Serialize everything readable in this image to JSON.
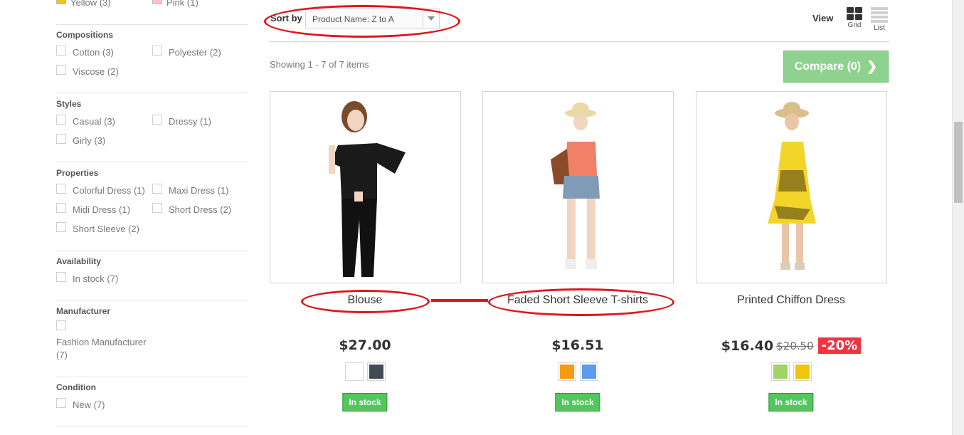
{
  "sidebar": {
    "colors_partial": [
      {
        "label": "Yellow (3)",
        "swatch": "#f1c40f"
      },
      {
        "label": "Pink (1)",
        "swatch": "#fcc2c6"
      }
    ],
    "compositions": {
      "title": "Compositions",
      "options": [
        "Cotton (3)",
        "Polyester (2)",
        "Viscose (2)"
      ]
    },
    "styles": {
      "title": "Styles",
      "options": [
        "Casual (3)",
        "Dressy (1)",
        "Girly (3)"
      ]
    },
    "properties": {
      "title": "Properties",
      "options": [
        "Colorful Dress (1)",
        "Maxi Dress (1)",
        "Midi Dress (1)",
        "Short Dress (2)",
        "Short Sleeve (2)"
      ]
    },
    "availability": {
      "title": "Availability",
      "options": [
        "In stock (7)"
      ]
    },
    "manufacturer": {
      "title": "Manufacturer",
      "options": [
        "Fashion Manufacturer",
        "(7)"
      ]
    },
    "condition": {
      "title": "Condition",
      "options": [
        "New (7)"
      ]
    }
  },
  "toolbar": {
    "sort_label": "Sort by",
    "sort_value": "Product Name: Z to A",
    "view_label": "View",
    "grid_label": "Grid",
    "list_label": "List",
    "showing": "Showing 1 - 7 of 7 items",
    "compare_label": "Compare (0)"
  },
  "products": [
    {
      "name": "Blouse",
      "price": "$27.00",
      "colors": [
        "#ffffff",
        "#434a54"
      ],
      "stock": "In stock"
    },
    {
      "name": "Faded Short Sleeve T-shirts",
      "price": "$16.51",
      "colors": [
        "#f39c11",
        "#5d9cec"
      ],
      "stock": "In stock"
    },
    {
      "name": "Printed Chiffon Dress",
      "price": "$16.40",
      "old_price": "$20.50",
      "discount": "-20%",
      "colors": [
        "#a0d468",
        "#f1c40f"
      ],
      "stock": "In stock"
    }
  ],
  "theme": {
    "annotation_color": "#e0161d",
    "in_stock_color": "#55c65e",
    "compare_color": "#8fd28f",
    "discount_color": "#f13340"
  }
}
